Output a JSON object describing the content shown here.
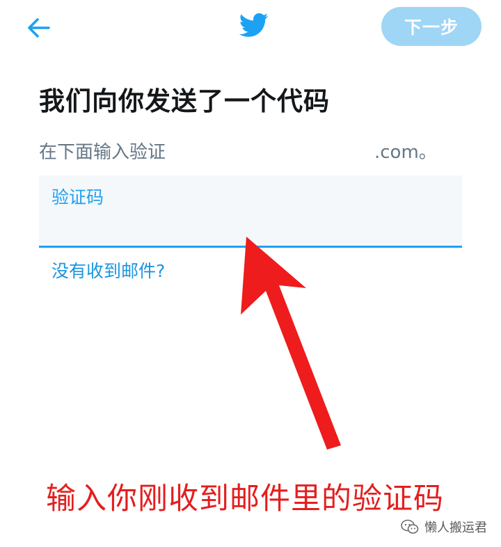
{
  "header": {
    "back_icon": "arrow-left-icon",
    "logo_icon": "twitter-bird-icon",
    "next_label": "下一步"
  },
  "main": {
    "title": "我们向你发送了一个代码",
    "subtitle_prefix": "在下面输入验证",
    "subtitle_suffix": ".com。",
    "code_field": {
      "label": "验证码",
      "value": ""
    },
    "no_mail_link": "没有收到邮件?"
  },
  "annotation": {
    "caption": "输入你刚收到邮件里的验证码",
    "arrow_icon": "red-arrow-up-icon"
  },
  "watermark": {
    "icon": "wechat-icon",
    "text": "懒人搬运君"
  },
  "colors": {
    "accent": "#1da1f2",
    "next_button": "#9fd5f5",
    "caption": "#e41e1e",
    "arrow": "#ee1c1c"
  }
}
